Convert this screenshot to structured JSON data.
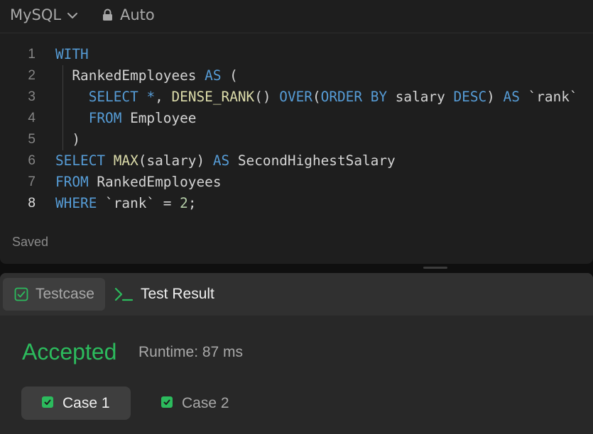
{
  "toolbar": {
    "language": "MySQL",
    "mode": "Auto"
  },
  "editor": {
    "lines": [
      {
        "num": "1",
        "tokens": [
          {
            "t": "WITH",
            "c": "kw"
          }
        ]
      },
      {
        "num": "2",
        "tokens": [
          {
            "t": "  RankedEmployees ",
            "c": ""
          },
          {
            "t": "AS",
            "c": "kw"
          },
          {
            "t": " (",
            "c": ""
          }
        ]
      },
      {
        "num": "3",
        "tokens": [
          {
            "t": "    ",
            "c": ""
          },
          {
            "t": "SELECT",
            "c": "kw"
          },
          {
            "t": " ",
            "c": ""
          },
          {
            "t": "*",
            "c": "kw"
          },
          {
            "t": ", ",
            "c": ""
          },
          {
            "t": "DENSE_RANK",
            "c": "fn"
          },
          {
            "t": "() ",
            "c": ""
          },
          {
            "t": "OVER",
            "c": "kw"
          },
          {
            "t": "(",
            "c": ""
          },
          {
            "t": "ORDER BY",
            "c": "kw"
          },
          {
            "t": " salary ",
            "c": ""
          },
          {
            "t": "DESC",
            "c": "kw"
          },
          {
            "t": ") ",
            "c": ""
          },
          {
            "t": "AS",
            "c": "kw"
          },
          {
            "t": " `rank`",
            "c": ""
          }
        ]
      },
      {
        "num": "4",
        "tokens": [
          {
            "t": "    ",
            "c": ""
          },
          {
            "t": "FROM",
            "c": "kw"
          },
          {
            "t": " Employee",
            "c": ""
          }
        ]
      },
      {
        "num": "5",
        "tokens": [
          {
            "t": "  )",
            "c": ""
          }
        ]
      },
      {
        "num": "6",
        "tokens": [
          {
            "t": "SELECT",
            "c": "kw"
          },
          {
            "t": " ",
            "c": ""
          },
          {
            "t": "MAX",
            "c": "fn"
          },
          {
            "t": "(salary) ",
            "c": ""
          },
          {
            "t": "AS",
            "c": "kw"
          },
          {
            "t": " SecondHighestSalary",
            "c": ""
          }
        ]
      },
      {
        "num": "7",
        "tokens": [
          {
            "t": "FROM",
            "c": "kw"
          },
          {
            "t": " RankedEmployees",
            "c": ""
          }
        ]
      },
      {
        "num": "8",
        "tokens": [
          {
            "t": "WHERE",
            "c": "kw"
          },
          {
            "t": " `rank` = ",
            "c": ""
          },
          {
            "t": "2",
            "c": "num"
          },
          {
            "t": ";",
            "c": ""
          }
        ]
      }
    ],
    "active_line": "8",
    "save_status": "Saved"
  },
  "result_panel": {
    "tabs": [
      {
        "label": "Testcase"
      },
      {
        "label": "Test Result"
      }
    ],
    "status": "Accepted",
    "runtime": "Runtime: 87 ms",
    "cases": [
      {
        "label": "Case 1"
      },
      {
        "label": "Case 2"
      }
    ]
  },
  "colors": {
    "accent_green": "#2cbb5d",
    "keyword": "#569cd6",
    "function": "#dcdcaa",
    "number": "#b5cea8"
  },
  "icons": {
    "language_chevron": "chevron-down-icon",
    "mode_lock": "lock-icon",
    "testcase_tab": "checkbox-icon",
    "result_tab": "terminal-prompt-icon",
    "case_status": "check-icon"
  }
}
